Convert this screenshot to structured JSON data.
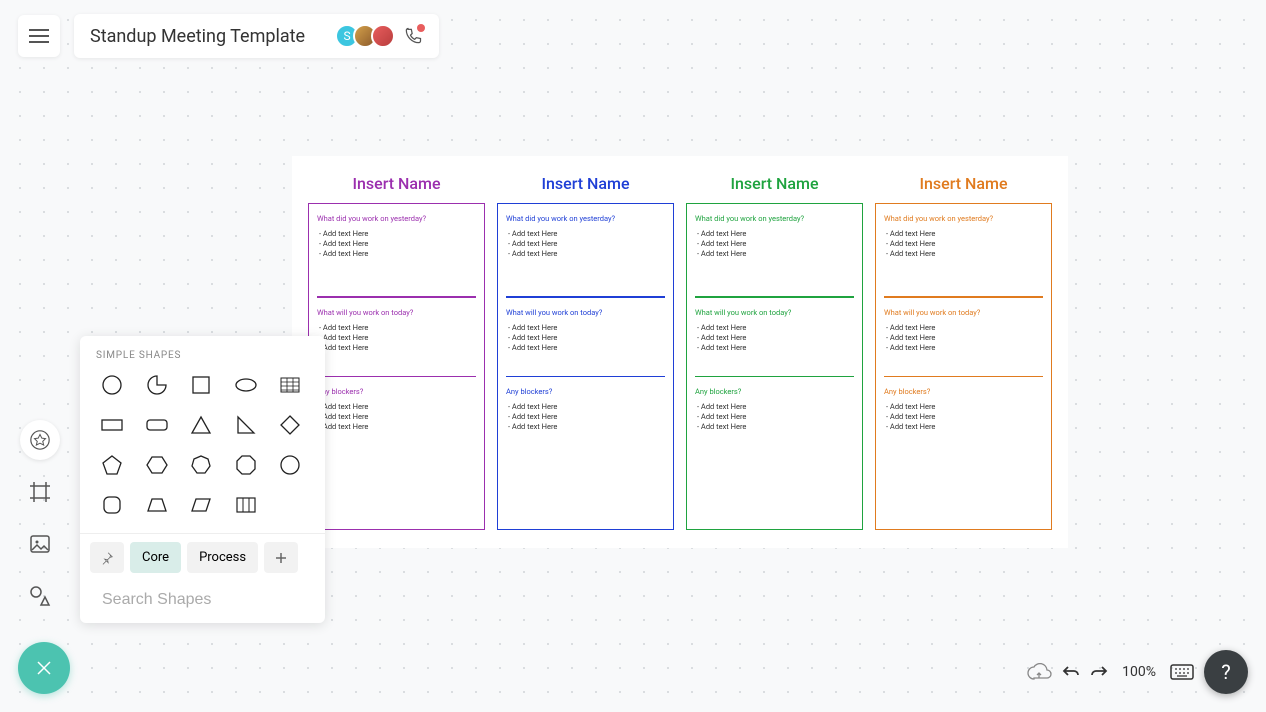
{
  "header": {
    "title": "Standup Meeting Template",
    "avatar_letter": "S"
  },
  "shapes_panel": {
    "title": "SIMPLE SHAPES",
    "tabs": {
      "core": "Core",
      "process": "Process"
    },
    "search_placeholder": "Search Shapes",
    "shape_names": [
      "circle",
      "arc",
      "square",
      "ellipse",
      "table",
      "rectangle",
      "rounded-rectangle",
      "triangle",
      "right-triangle",
      "diamond",
      "pentagon",
      "hexagon",
      "heptagon",
      "octagon",
      "circle-2",
      "rounded-square",
      "trapezoid",
      "parallelogram",
      "grid"
    ]
  },
  "canvas_columns": [
    {
      "name": "Insert Name",
      "color": "#9b2fae",
      "sections": [
        {
          "q": "What did you work on yesterday?",
          "items": [
            "- Add   text   Here",
            "- Add   text   Here",
            "- Add   text   Here"
          ]
        },
        {
          "q": "What will you work on today?",
          "items": [
            "- Add   text   Here",
            "- Add   text   Here",
            "- Add   text   Here"
          ]
        },
        {
          "q": "Any blockers?",
          "items": [
            "- Add   text   Here",
            "- Add   text   Here",
            "- Add   text   Here"
          ]
        }
      ]
    },
    {
      "name": "Insert Name",
      "color": "#1f3fd6",
      "sections": [
        {
          "q": "What did you work on yesterday?",
          "items": [
            "- Add   text   Here",
            "- Add   text   Here",
            "- Add   text   Here"
          ]
        },
        {
          "q": "What will you work on today?",
          "items": [
            "- Add   text   Here",
            "- Add   text   Here",
            "- Add   text   Here"
          ]
        },
        {
          "q": "Any blockers?",
          "items": [
            "- Add   text   Here",
            "- Add   text   Here",
            "- Add   text   Here"
          ]
        }
      ]
    },
    {
      "name": "Insert Name",
      "color": "#1fa33f",
      "sections": [
        {
          "q": "What did you work  on yesterday?",
          "items": [
            "- Add   text   Here",
            "- Add   text   Here",
            "- Add   text   Here"
          ]
        },
        {
          "q": "What will you work on today?",
          "items": [
            "- Add   text   Here",
            "- Add   text   Here",
            "- Add   text   Here"
          ]
        },
        {
          "q": "Any blockers?",
          "items": [
            "- Add   text   Here",
            "- Add   text   Here",
            "- Add   text   Here"
          ]
        }
      ]
    },
    {
      "name": "Insert Name",
      "color": "#e07b1f",
      "sections": [
        {
          "q": "What did you work on yesterday?",
          "items": [
            "- Add   text   Here",
            "- Add   text   Here",
            "- Add   text   Here"
          ]
        },
        {
          "q": "What will you work on today?",
          "items": [
            "- Add   text   Here",
            "- Add   text   Here",
            "- Add   text   Here"
          ]
        },
        {
          "q": "Any blockers?",
          "items": [
            "- Add   text   Here",
            "- Add   text   Here",
            "- Add   text   Here"
          ]
        }
      ]
    }
  ],
  "footer": {
    "zoom": "100%",
    "help": "?"
  }
}
